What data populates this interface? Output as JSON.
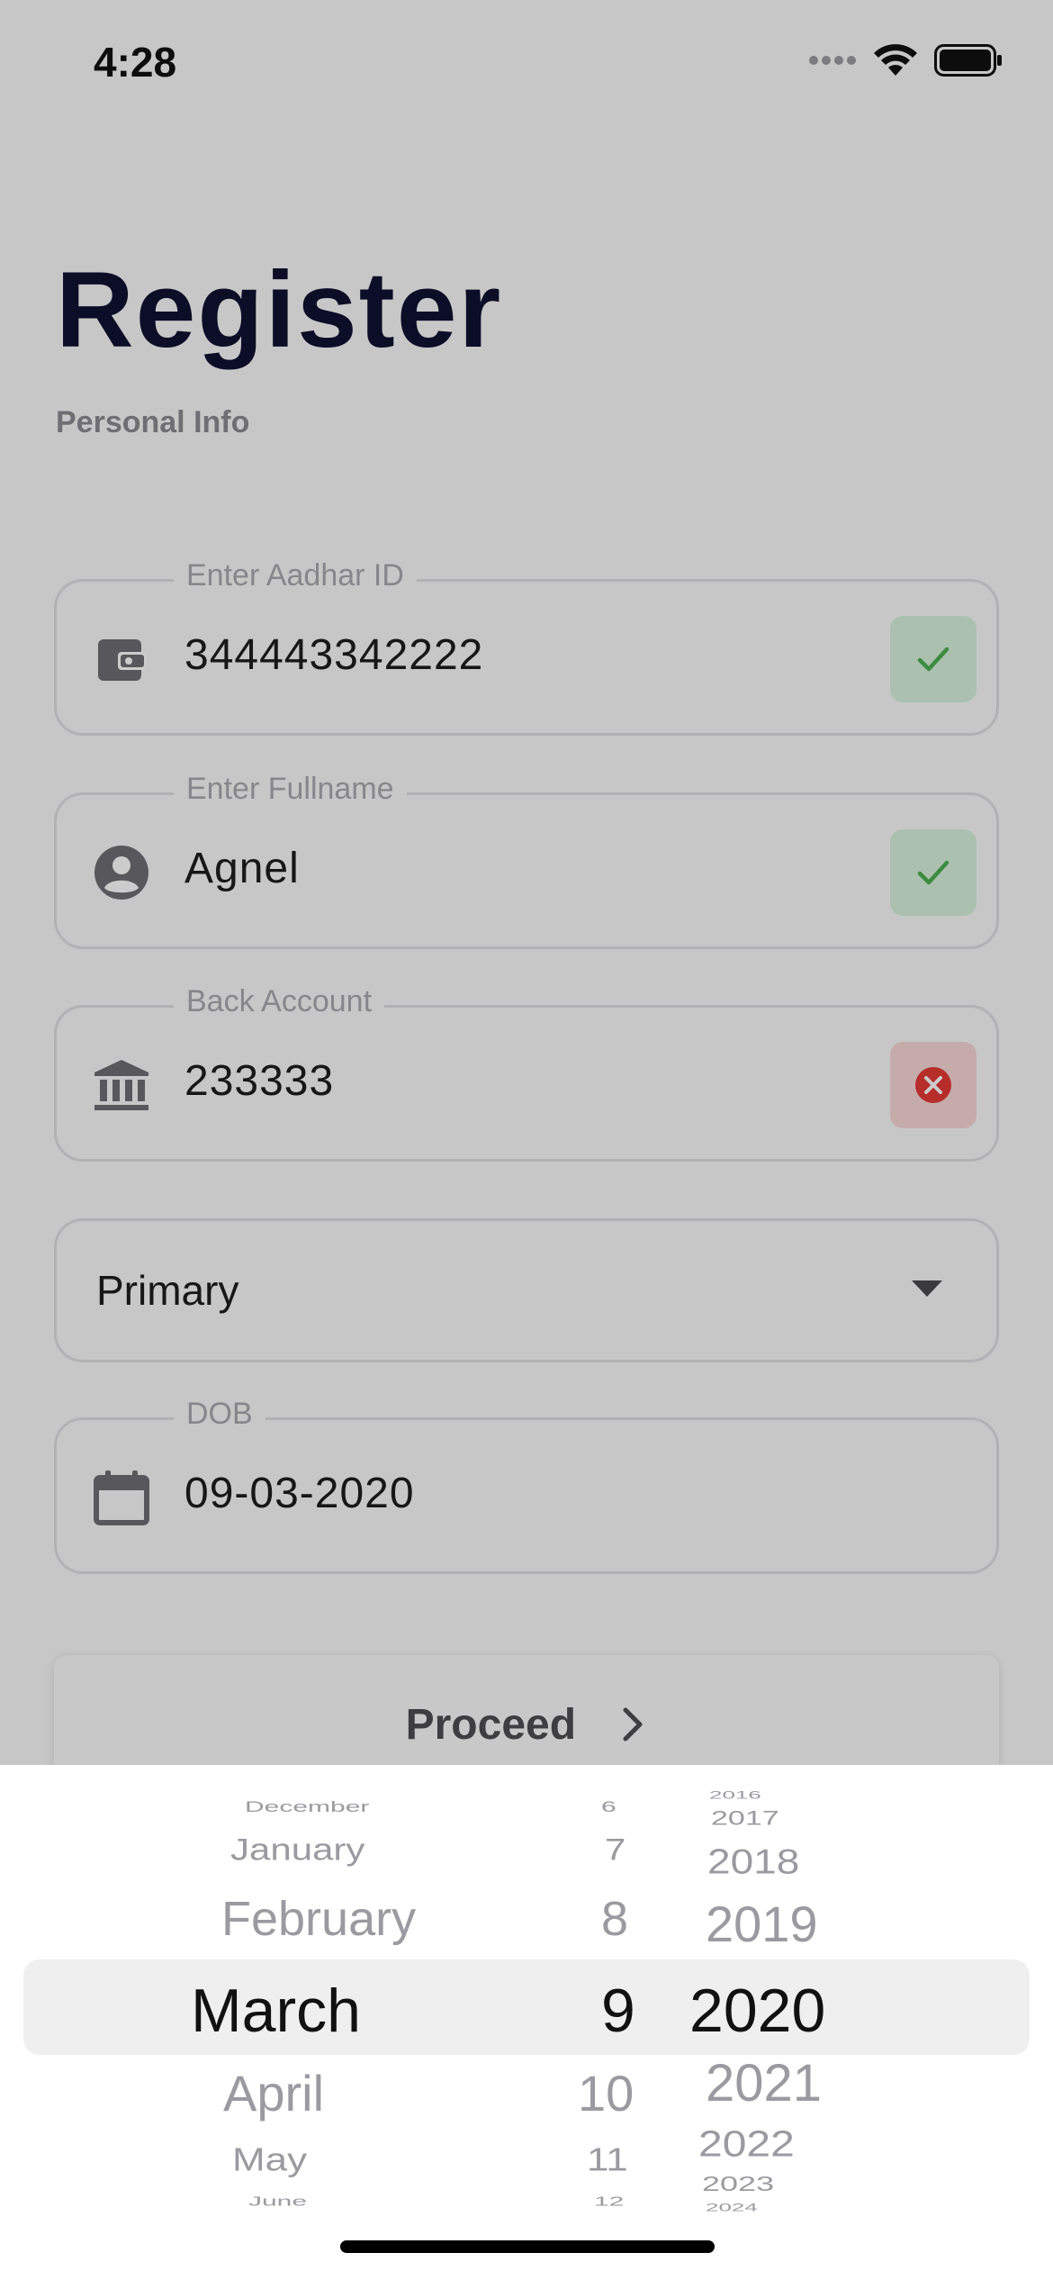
{
  "status_bar": {
    "time": "4:28"
  },
  "header": {
    "title": "Register",
    "subtitle": "Personal Info"
  },
  "form": {
    "aadhar": {
      "label": "Enter Aadhar ID",
      "value": "344443342222",
      "status": "valid",
      "icon": "wallet-icon"
    },
    "fullname": {
      "label": "Enter Fullname",
      "value": "Agnel",
      "status": "valid",
      "icon": "account-circle-icon"
    },
    "bank": {
      "label": "Back Account",
      "value": "233333",
      "status": "invalid",
      "icon": "bank-icon"
    },
    "account_type": {
      "value": "Primary",
      "icon": "caret-down-icon"
    },
    "dob": {
      "label": "DOB",
      "value": "09-03-2020",
      "icon": "calendar-icon"
    }
  },
  "proceed_button": {
    "label": "Proceed",
    "icon": "chevron-right-icon"
  },
  "date_picker": {
    "months": [
      "December",
      "January",
      "February",
      "March",
      "April",
      "May",
      "June"
    ],
    "days": [
      "6",
      "7",
      "8",
      "9",
      "10",
      "11",
      "12"
    ],
    "years": [
      "2016",
      "2017",
      "2018",
      "2019",
      "2020",
      "2021",
      "2022",
      "2023",
      "2024"
    ],
    "selected": {
      "month": "March",
      "day": "9",
      "year": "2020"
    }
  },
  "colors": {
    "title": "#0f1130",
    "valid_icon": "#4caf50",
    "invalid_icon": "#e53935",
    "overlay": "rgba(0,0,0,0.20)"
  }
}
